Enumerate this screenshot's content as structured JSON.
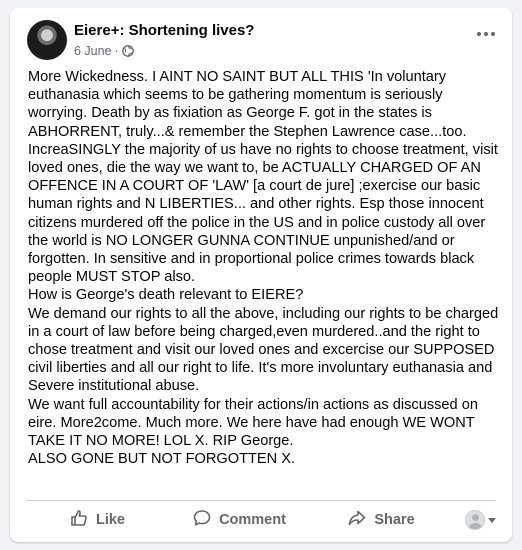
{
  "post": {
    "author": "Eiere+: Shortening lives?",
    "date": "6 June",
    "date_sep": "·",
    "audience_icon": "globe-icon",
    "more_icon": "more-options-icon",
    "paragraphs": [
      "More Wickedness.  I AINT NO SAINT BUT ALL THIS 'In voluntary euthanasia which seems to be gathering momentum is seriously worrying.  Death by as fixiation as George F. got in the states is ABHORRENT, truly...& remember the Stephen Lawrence case...too. IncreaSINGLY the majority of us have no rights to choose treatment, visit loved ones, die the way we want to, be ACTUALLY CHARGED OF AN OFFENCE IN A COURT OF 'LAW' [a court de jure] ;exercise our basic human rights and N LIBERTIES... and other rights. Esp those innocent citizens murdered off the police in the US and in police custody all over the world is NO LONGER GUNNA CONTINUE unpunished/and or forgotten. In sensitive and in proportional police crimes towards black people MUST STOP also.",
      "How is George's death relevant to EIERE?",
      " We demand our rights to all the above, including our rights to be charged in a court of law before being charged,even  murdered..and the right to chose treatment and visit our loved ones and excercise our SUPPOSED civil liberties and all our right to life.  It's more involuntary euthanasia and Severe institutional abuse.",
      " We want full accountability for their actions/in actions as discussed on eire.  More2come.  Much more.  We here have had enough WE WONT TAKE IT NO MORE! LOL X. RIP George.",
      "ALSO GONE BUT NOT FORGOTTEN X."
    ]
  },
  "actions": {
    "like": "Like",
    "comment": "Comment",
    "share": "Share"
  },
  "colors": {
    "text": "#050505",
    "muted": "#65676b",
    "background": "#f0f2f5",
    "card": "#ffffff"
  }
}
